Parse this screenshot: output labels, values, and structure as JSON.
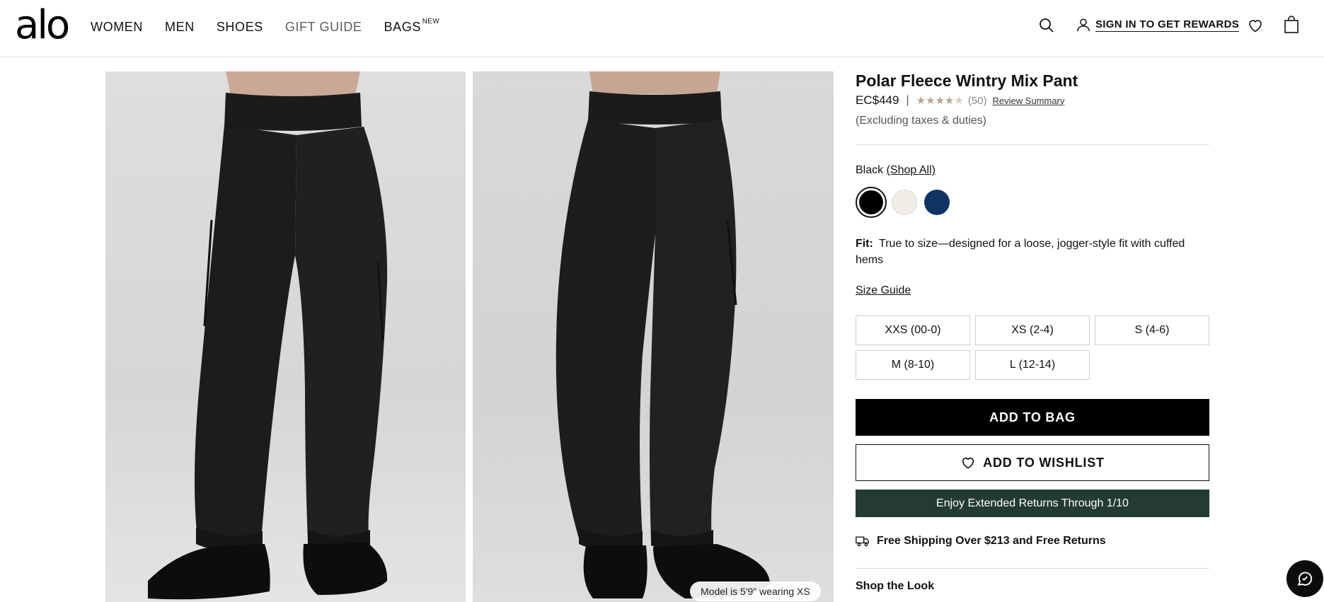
{
  "header": {
    "logo": "alo",
    "nav": [
      {
        "label": "WOMEN"
      },
      {
        "label": "MEN"
      },
      {
        "label": "SHOES"
      },
      {
        "label": "GIFT GUIDE"
      },
      {
        "label": "BAGS",
        "badge": "NEW"
      }
    ],
    "signin_label": "SIGN IN TO GET REWARDS",
    "icons": [
      "search-icon",
      "user-icon",
      "heart-icon",
      "bag-icon"
    ]
  },
  "gallery": {
    "model_note": "Model is 5'9\" wearing XS"
  },
  "product": {
    "title": "Polar Fleece Wintry Mix Pant",
    "price": "EC$449",
    "separator": "|",
    "rating": 4.5,
    "stars": "★★★★",
    "half_star": "★",
    "review_count": "(50)",
    "review_summary_label": "Review Summary",
    "taxes_note": "(Excluding taxes & duties)",
    "color_name": "Black",
    "shop_all_label": "(Shop All)",
    "swatches": [
      {
        "name": "Black",
        "hex": "#000000",
        "selected": true
      },
      {
        "name": "Ivory",
        "hex": "#efede6",
        "selected": false
      },
      {
        "name": "Navy",
        "hex": "#0e3566",
        "selected": false
      }
    ],
    "fit_label": "Fit:",
    "fit_text": "True to size—designed for a loose, jogger-style fit with cuffed hems",
    "size_guide_label": "Size Guide",
    "sizes": [
      "XXS (00-0)",
      "XS (2-4)",
      "S (4-6)",
      "M (8-10)",
      "L (12-14)"
    ],
    "add_to_bag_label": "ADD TO BAG",
    "add_to_wishlist_label": "ADD TO WISHLIST",
    "returns_banner": "Enjoy Extended Returns Through 1/10",
    "shipping_label": "Free Shipping Over $213 and Free Returns",
    "shop_the_look_label": "Shop the Look"
  },
  "colors": {
    "banner_bg": "#233b33",
    "primary": "#000000",
    "star": "#b8a58a"
  }
}
